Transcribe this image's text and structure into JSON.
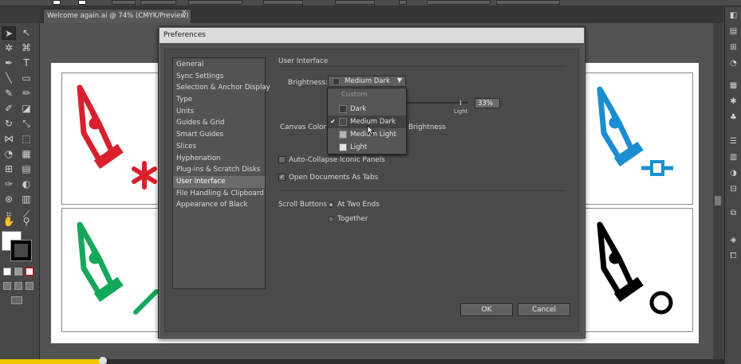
{
  "document_tab": {
    "title": "Welcome again.ai @ 74% (CMYK/Preview)",
    "close": "×"
  },
  "dialog": {
    "title": "Preferences",
    "categories": [
      {
        "label": "General"
      },
      {
        "label": "Sync Settings"
      },
      {
        "label": "Selection & Anchor Display"
      },
      {
        "label": "Type"
      },
      {
        "label": "Units"
      },
      {
        "label": "Guides & Grid"
      },
      {
        "label": "Smart Guides"
      },
      {
        "label": "Slices"
      },
      {
        "label": "Hyphenation"
      },
      {
        "label": "Plug-ins & Scratch Disks"
      },
      {
        "label": "User Interface"
      },
      {
        "label": "File Handling & Clipboard"
      },
      {
        "label": "Appearance of Black"
      }
    ],
    "selected_category": "User Interface",
    "section_title": "User Interface",
    "brightness": {
      "label": "Brightness:",
      "value": "Medium Dark",
      "slider_end_label": "Light",
      "percent": "33%"
    },
    "canvas_color": {
      "label": "Canvas Color:",
      "option_suffix": "Brightness"
    },
    "dropdown": {
      "header": "Custom",
      "options": [
        {
          "label": "Dark",
          "swatch": "#3a3a3a"
        },
        {
          "label": "Medium Dark",
          "swatch": "#4a4a4a",
          "checked": true
        },
        {
          "label": "Medium Light",
          "swatch": "#b4b4b4"
        },
        {
          "label": "Light",
          "swatch": "#e4e4e4"
        }
      ]
    },
    "auto_collapse": {
      "label": "Auto-Collapse Iconic Panels",
      "checked": false
    },
    "open_as_tabs": {
      "label": "Open Documents As Tabs",
      "checked": true
    },
    "scroll_buttons": {
      "label": "Scroll Buttons:",
      "options": [
        {
          "label": "At Two Ends",
          "selected": true
        },
        {
          "label": "Together",
          "selected": false
        }
      ]
    },
    "ok_label": "OK",
    "cancel_label": "Cancel"
  },
  "colors": {
    "pen_red": "#d9202c",
    "pen_blue": "#1a8ed0",
    "pen_green": "#14a85a",
    "pen_black": "#000000"
  }
}
